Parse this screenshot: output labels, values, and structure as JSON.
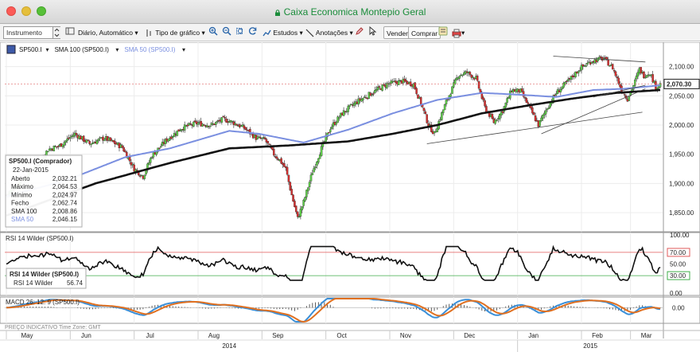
{
  "window": {
    "title": "Caixa Economica Montepio Geral"
  },
  "toolbar": {
    "instrument_placeholder": "Instrumento",
    "period": "Diário,",
    "period_mode": "Automático",
    "chart_type": "Tipo de gráfico",
    "studies": "Estudos",
    "annotations": "Anotações",
    "sell": "Vender",
    "buy": "Comprar"
  },
  "main_panel": {
    "legend": [
      {
        "label": "SP500.I",
        "color": "#111111"
      },
      {
        "label": "SMA 100 (SP500.I)",
        "color": "#111111"
      },
      {
        "label": "SMA 50 (SP500.I)",
        "color": "#7a8fe0"
      }
    ],
    "last_price_badge": "2,070.30",
    "price_ticks": [
      "2,100.00",
      "2,050.00",
      "2,000.00",
      "1,950.00",
      "1,900.00",
      "1,850.00"
    ],
    "infobox": {
      "title": "SP500.I (Comprador)",
      "date": "22-Jan-2015",
      "rows": [
        {
          "label": "Aberto",
          "value": "2,032.21"
        },
        {
          "label": "Máximo",
          "value": "2,064.53"
        },
        {
          "label": "Mínimo",
          "value": "2,024.97"
        },
        {
          "label": "Fecho",
          "value": "2,062.74"
        },
        {
          "label": "SMA 100",
          "value": "2,008.86"
        },
        {
          "label": "SMA 50",
          "value": "2,046.15"
        }
      ]
    }
  },
  "rsi_panel": {
    "title": "RSI 14 Wilder (SP500.I)",
    "ticks": [
      "100.00",
      "70.00",
      "50.00",
      "30.00",
      "0.00"
    ],
    "infobox": {
      "title": "RSI 14 Wilder (SP500.I)",
      "label": "RSI 14 Wilder",
      "value": "56.74"
    }
  },
  "macd_panel": {
    "title": "MACD 26: 12: 9 (SP500.I)",
    "ticks": [
      "0.00"
    ]
  },
  "footer": {
    "label": "PREÇO INDICATIVO",
    "timezone": "Time Zone: GMT"
  },
  "x_axis": {
    "months": [
      "May",
      "Jun",
      "Jul",
      "Aug",
      "Sep",
      "Oct",
      "Nov",
      "Dec",
      "Jan",
      "Feb",
      "Mar"
    ],
    "years": [
      "2014",
      "2015"
    ]
  },
  "chart_data": {
    "type": "candlestick",
    "instrument": "SP500.I",
    "ylim": [
      1820,
      2120
    ],
    "anchors": [
      [
        0,
        1880
      ],
      [
        10,
        1905
      ],
      [
        20,
        1928
      ],
      [
        28,
        1958
      ],
      [
        36,
        1965
      ],
      [
        46,
        1985
      ],
      [
        56,
        1968
      ],
      [
        66,
        1978
      ],
      [
        78,
        1962
      ],
      [
        86,
        1925
      ],
      [
        92,
        1912
      ],
      [
        98,
        1948
      ],
      [
        108,
        1975
      ],
      [
        118,
        1995
      ],
      [
        128,
        2003
      ],
      [
        138,
        2000
      ],
      [
        146,
        2010
      ],
      [
        152,
        2005
      ],
      [
        160,
        1995
      ],
      [
        168,
        1978
      ],
      [
        174,
        1975
      ],
      [
        180,
        1950
      ],
      [
        184,
        1940
      ],
      [
        188,
        1925
      ],
      [
        192,
        1880
      ],
      [
        196,
        1840
      ],
      [
        200,
        1868
      ],
      [
        206,
        1920
      ],
      [
        212,
        1960
      ],
      [
        218,
        1995
      ],
      [
        226,
        2020
      ],
      [
        236,
        2040
      ],
      [
        246,
        2055
      ],
      [
        256,
        2070
      ],
      [
        266,
        2075
      ],
      [
        274,
        2070
      ],
      [
        280,
        2030
      ],
      [
        284,
        2000
      ],
      [
        288,
        1985
      ],
      [
        296,
        2040
      ],
      [
        304,
        2085
      ],
      [
        310,
        2090
      ],
      [
        316,
        2080
      ],
      [
        322,
        2030
      ],
      [
        328,
        2005
      ],
      [
        334,
        2025
      ],
      [
        340,
        2060
      ],
      [
        346,
        2058
      ],
      [
        352,
        2030
      ],
      [
        358,
        2000
      ],
      [
        364,
        2030
      ],
      [
        370,
        2055
      ],
      [
        378,
        2075
      ],
      [
        386,
        2097
      ],
      [
        394,
        2110
      ],
      [
        402,
        2114
      ],
      [
        408,
        2098
      ],
      [
        414,
        2060
      ],
      [
        418,
        2045
      ],
      [
        422,
        2068
      ],
      [
        426,
        2095
      ],
      [
        429,
        2085
      ],
      [
        433,
        2090
      ],
      [
        437,
        2065
      ],
      [
        440,
        2070
      ]
    ],
    "sma50_anchors": [
      [
        0,
        1878
      ],
      [
        40,
        1905
      ],
      [
        80,
        1945
      ],
      [
        110,
        1960
      ],
      [
        150,
        1990
      ],
      [
        170,
        1985
      ],
      [
        200,
        1970
      ],
      [
        230,
        1992
      ],
      [
        260,
        2020
      ],
      [
        290,
        2043
      ],
      [
        320,
        2055
      ],
      [
        345,
        2052
      ],
      [
        370,
        2048
      ],
      [
        395,
        2060
      ],
      [
        415,
        2062
      ],
      [
        440,
        2068
      ]
    ],
    "sma100_anchors": [
      [
        0,
        1845
      ],
      [
        60,
        1900
      ],
      [
        110,
        1935
      ],
      [
        150,
        1960
      ],
      [
        190,
        1965
      ],
      [
        230,
        1972
      ],
      [
        260,
        1985
      ],
      [
        290,
        2000
      ],
      [
        320,
        2020
      ],
      [
        350,
        2033
      ],
      [
        380,
        2045
      ],
      [
        410,
        2055
      ],
      [
        440,
        2060
      ]
    ],
    "rsi_ylim": [
      0,
      100
    ],
    "rsi_levels": [
      70,
      30
    ],
    "macd_ylim": [
      -28,
      18
    ]
  }
}
